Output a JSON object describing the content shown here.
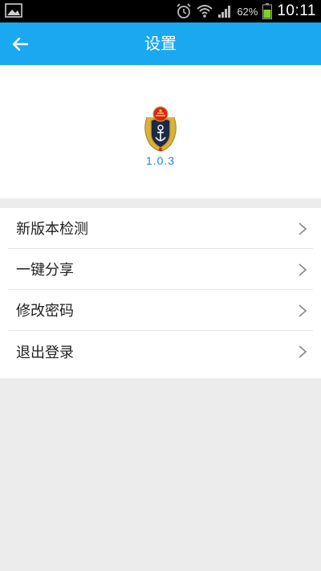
{
  "status_bar": {
    "battery_percent": "62%",
    "time": "10:11",
    "icons": [
      "gallery-icon",
      "alarm-icon",
      "wifi-icon",
      "signal-icon",
      "battery-icon"
    ]
  },
  "appbar": {
    "title": "设置",
    "back_icon": "back-arrow-icon",
    "color": "#1aa9f0"
  },
  "app_info": {
    "logo": "emblem-logo",
    "version": "1.0.3"
  },
  "menu": {
    "items": [
      {
        "label": "新版本检测"
      },
      {
        "label": "一键分享"
      },
      {
        "label": "修改密码"
      },
      {
        "label": "退出登录"
      }
    ]
  }
}
